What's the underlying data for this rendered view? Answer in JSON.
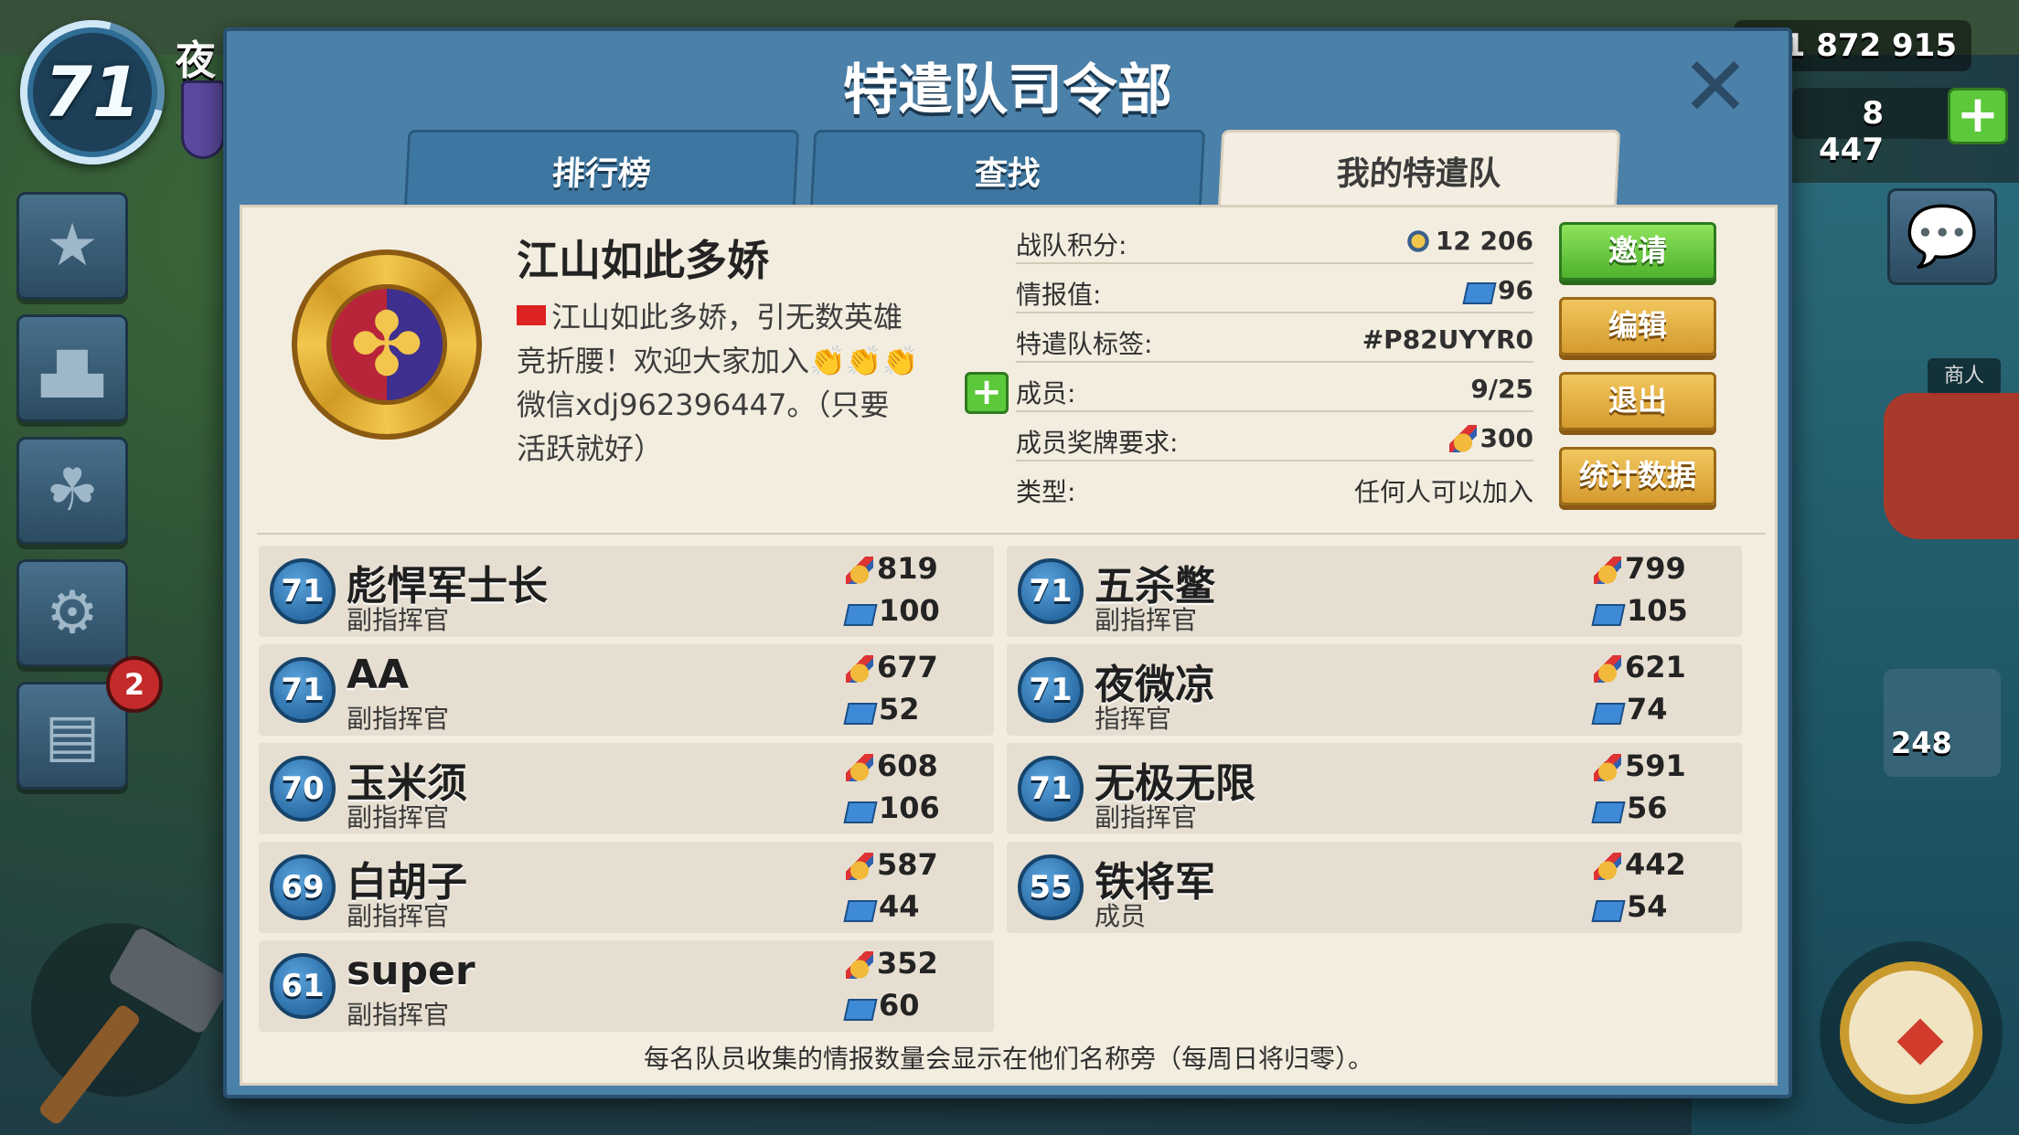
{
  "hud": {
    "player_level": "71",
    "player_name": "夜",
    "gold": "1 872 915",
    "diamonds": "8 447",
    "plus_label": "+",
    "notification_count": "2",
    "merchant_label": "商人",
    "troop_count": "248"
  },
  "panel": {
    "title": "特遣队司令部",
    "close_label": "✕",
    "tabs": [
      "排行榜",
      "查找",
      "我的特遣队"
    ],
    "active_tab": "我的特遣队"
  },
  "team": {
    "name": "江山如此多娇",
    "description_line1": "江山如此多娇，引无数英雄",
    "description_line2": "竞折腰！欢迎大家加入👏👏👏",
    "description_line3": "微信xdj962396447。（只要",
    "description_line4": "活跃就好）",
    "info": {
      "score_label": "战队积分:",
      "score_value": "12 206",
      "intel_label": "情报值:",
      "intel_value": "96",
      "tag_label": "特遣队标签:",
      "tag_value": "#P82UYYR0",
      "members_label": "成员:",
      "members_value": "9/25",
      "medal_req_label": "成员奖牌要求:",
      "medal_req_value": "300",
      "type_label": "类型:",
      "type_value": "任何人可以加入"
    },
    "buttons": {
      "invite": "邀请",
      "edit": "编辑",
      "leave": "退出",
      "stats": "统计数据"
    }
  },
  "members": [
    {
      "level": "71",
      "name": "彪悍军士长",
      "role": "副指挥官",
      "medals": "819",
      "intel": "100"
    },
    {
      "level": "71",
      "name": "五杀鳖",
      "role": "副指挥官",
      "medals": "799",
      "intel": "105"
    },
    {
      "level": "71",
      "name": "AA",
      "role": "副指挥官",
      "medals": "677",
      "intel": "52"
    },
    {
      "level": "71",
      "name": "夜微凉",
      "role": "指挥官",
      "medals": "621",
      "intel": "74"
    },
    {
      "level": "70",
      "name": "玉米须",
      "role": "副指挥官",
      "medals": "608",
      "intel": "106"
    },
    {
      "level": "71",
      "name": "无极无限",
      "role": "副指挥官",
      "medals": "591",
      "intel": "56"
    },
    {
      "level": "69",
      "name": "白胡子",
      "role": "副指挥官",
      "medals": "587",
      "intel": "44"
    },
    {
      "level": "55",
      "name": "铁将军",
      "role": "成员",
      "medals": "442",
      "intel": "54"
    },
    {
      "level": "61",
      "name": "super",
      "role": "副指挥官",
      "medals": "352",
      "intel": "60"
    }
  ],
  "footer_note": "每名队员收集的情报数量会显示在他们名称旁（每周日将归零）。",
  "colors": {
    "panel_blue": "#4b80a8",
    "paper": "#f3ede0",
    "invite_green": "#5cc93a",
    "button_gold": "#d59a2f"
  }
}
